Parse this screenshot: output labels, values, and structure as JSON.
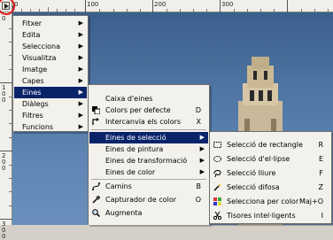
{
  "ruler": {
    "top_labels": [
      "0",
      "100",
      "200",
      "300"
    ],
    "left_labels": [
      "0",
      "100",
      "200",
      "300"
    ]
  },
  "main_menu": {
    "items": [
      {
        "label": "Fitxer",
        "submenu": true
      },
      {
        "label": "Edita",
        "submenu": true
      },
      {
        "label": "Selecciona",
        "submenu": true
      },
      {
        "label": "Visualitza",
        "submenu": true
      },
      {
        "label": "Imatge",
        "submenu": true
      },
      {
        "label": "Capes",
        "submenu": true
      },
      {
        "label": "Eines",
        "submenu": true,
        "selected": true
      },
      {
        "label": "Diàlegs",
        "submenu": true
      },
      {
        "label": "Filtres",
        "submenu": true
      },
      {
        "label": "Funcions",
        "submenu": true
      }
    ]
  },
  "eines_menu": {
    "items": [
      {
        "label": "Caixa d'eines",
        "shortcut": "",
        "icon": ""
      },
      {
        "label": "Colors per defecte",
        "shortcut": "D",
        "icon": "default-colors-icon"
      },
      {
        "label": "Intercanvia els colors",
        "shortcut": "X",
        "icon": "swap-colors-icon"
      },
      {
        "label": "Eines de selecció",
        "submenu": true,
        "selected": true
      },
      {
        "label": "Eines de pintura",
        "submenu": true
      },
      {
        "label": "Eines de transformació",
        "submenu": true
      },
      {
        "label": "Eines de color",
        "submenu": true
      },
      {
        "label": "Camins",
        "shortcut": "B",
        "icon": "paths-icon"
      },
      {
        "label": "Capturador de color",
        "shortcut": "O",
        "icon": "color-picker-icon"
      },
      {
        "label": "Augmenta",
        "shortcut": "",
        "icon": "zoom-icon"
      }
    ]
  },
  "selection_menu": {
    "items": [
      {
        "label": "Selecció de rectangle",
        "shortcut": "R",
        "icon": "rect-select-icon"
      },
      {
        "label": "Selecció d'el·lipse",
        "shortcut": "E",
        "icon": "ellipse-select-icon"
      },
      {
        "label": "Selecció lliure",
        "shortcut": "F",
        "icon": "lasso-icon"
      },
      {
        "label": "Selecció difosa",
        "shortcut": "Z",
        "icon": "fuzzy-select-icon"
      },
      {
        "label": "Selecciona per color",
        "shortcut": "Maj+O",
        "icon": "select-by-color-icon"
      },
      {
        "label": "Tisores intel·ligents",
        "shortcut": "I",
        "icon": "scissors-icon"
      }
    ]
  },
  "colors": {
    "menu_highlight": "#0a246a",
    "annotation_circle": "#e0191c"
  }
}
